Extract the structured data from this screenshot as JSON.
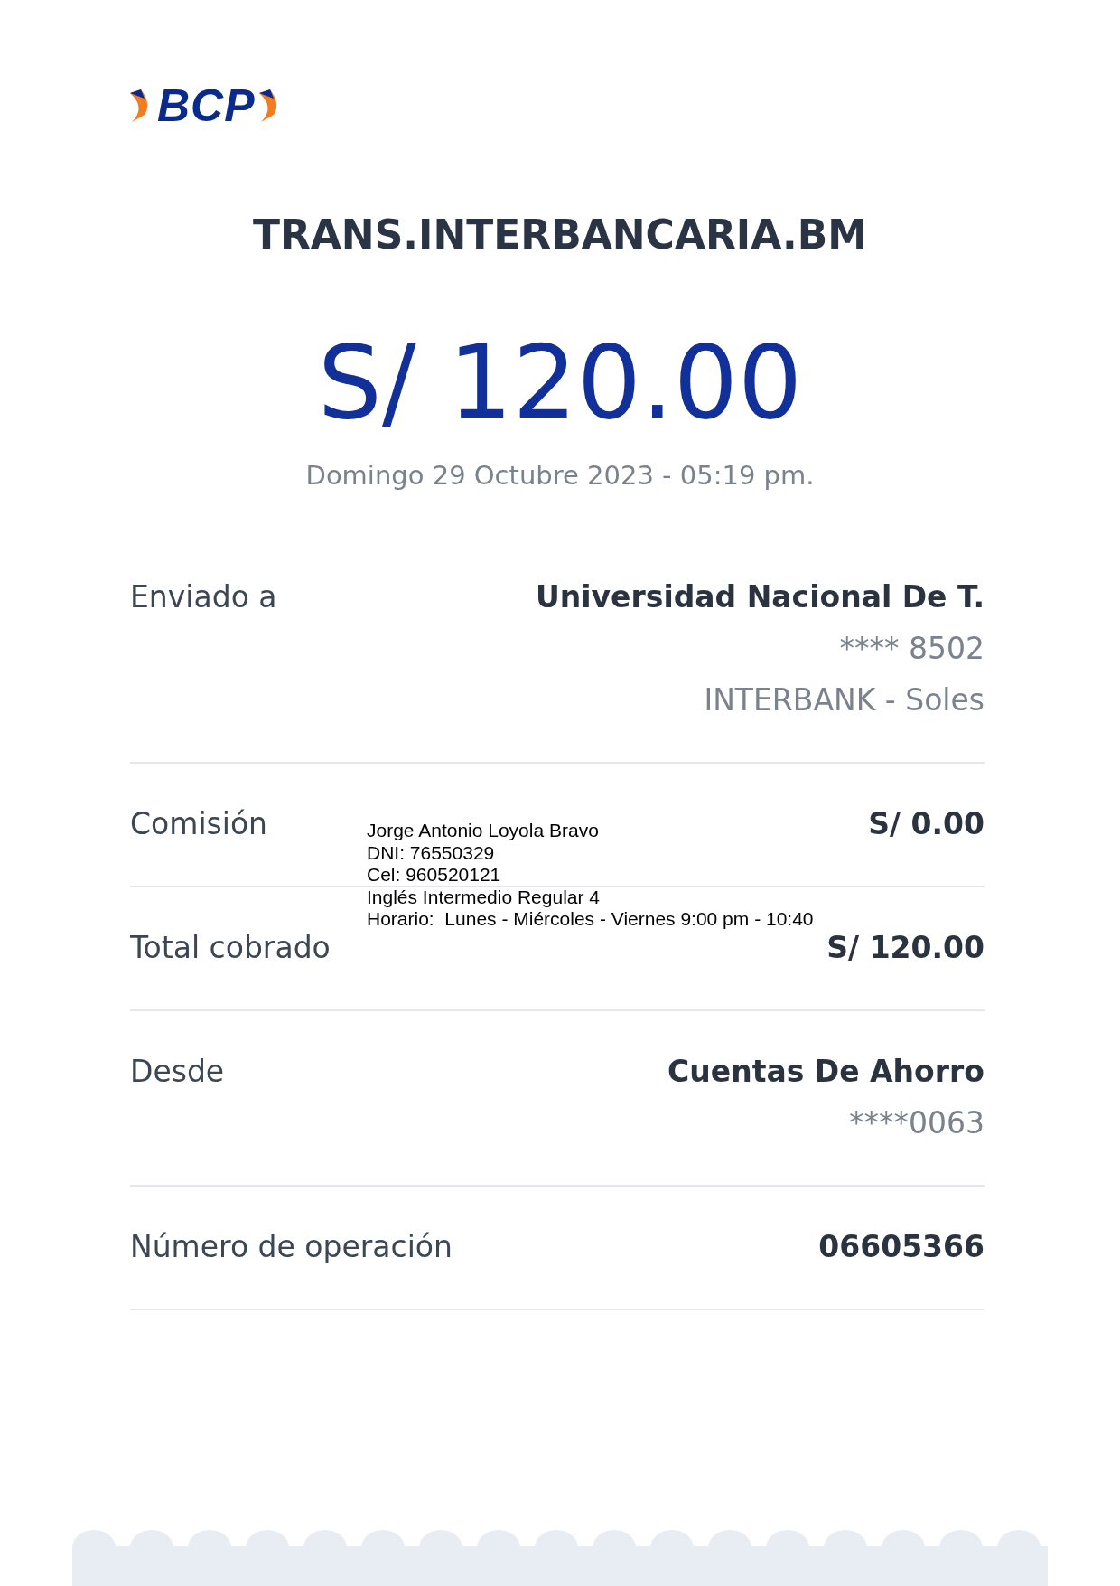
{
  "logo": {
    "text": "BCP"
  },
  "title": "TRANS.INTERBANCARIA.BM",
  "amount": "S/ 120.00",
  "datetime": "Domingo 29 Octubre 2023 - 05:19 pm.",
  "rows": [
    {
      "label": "Enviado a",
      "values": [
        {
          "text": "Universidad Nacional De T.",
          "kind": "bold"
        },
        {
          "text": "**** 8502",
          "kind": "plain"
        },
        {
          "text": "INTERBANK - Soles",
          "kind": "plain"
        }
      ]
    },
    {
      "label": "Comisión",
      "values": [
        {
          "text": "S/ 0.00",
          "kind": "bold"
        }
      ]
    },
    {
      "label": "Total cobrado",
      "values": [
        {
          "text": "S/ 120.00",
          "kind": "bold"
        }
      ]
    },
    {
      "label": "Desde",
      "values": [
        {
          "text": "Cuentas De Ahorro",
          "kind": "bold"
        },
        {
          "text": "****0063",
          "kind": "plain"
        }
      ]
    },
    {
      "label": "Número de operación",
      "values": [
        {
          "text": "06605366",
          "kind": "bold"
        }
      ]
    }
  ],
  "annotation": {
    "lines": [
      "Jorge Antonio Loyola Bravo",
      "DNI: 76550329",
      "Cel: 960520121",
      "Inglés Intermedio Regular 4",
      "Horario:  Lunes - Miércoles - Viernes 9:00 pm - 10:40"
    ]
  }
}
